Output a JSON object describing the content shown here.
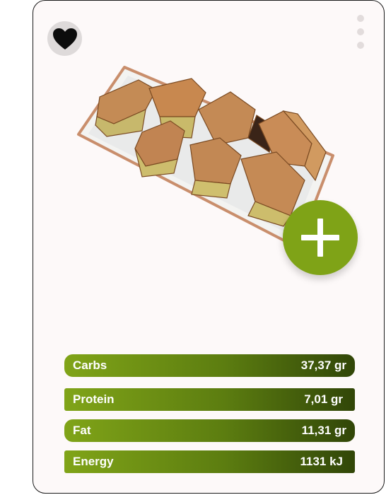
{
  "food": {
    "name": "",
    "description": ""
  },
  "nutrition": [
    {
      "label": "Carbs",
      "value": "37,37 gr"
    },
    {
      "label": "Protein",
      "value": "7,01 gr"
    },
    {
      "label": "Fat",
      "value": "11,31 gr"
    },
    {
      "label": "Energy",
      "value": "1131 kJ"
    }
  ],
  "icons": {
    "favorite": "heart-icon",
    "menu": "more-vertical-icon",
    "add": "plus-icon"
  },
  "colors": {
    "accent": "#7fa317",
    "bar_start": "#80a418",
    "bar_end": "#314608"
  }
}
